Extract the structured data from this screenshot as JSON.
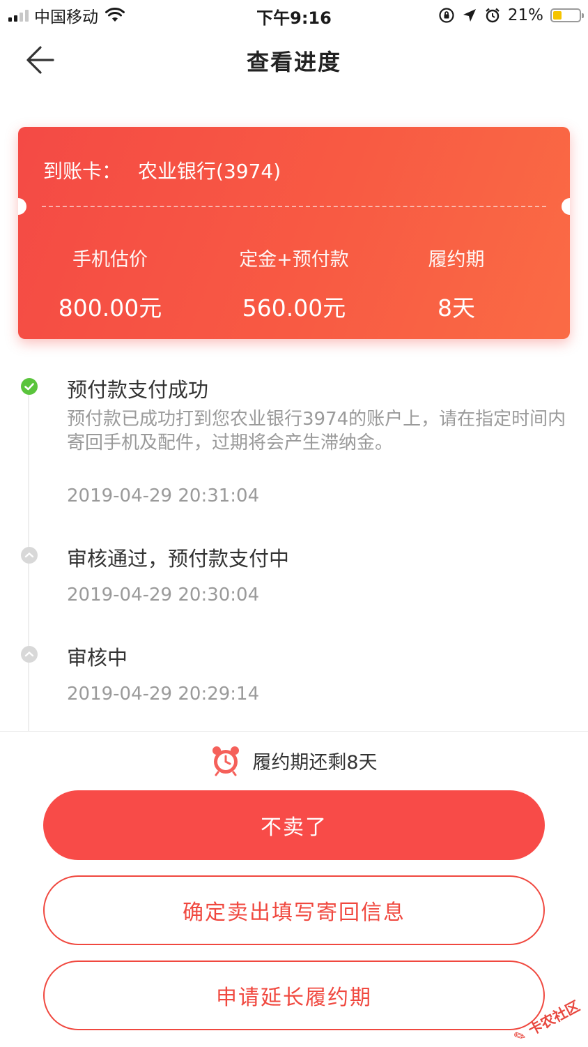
{
  "status_bar": {
    "carrier": "中国移动",
    "time": "下午9:16",
    "battery_percent": "21%",
    "battery_level": 0.21,
    "icons": [
      "signal-icon",
      "wifi-icon",
      "orientation-lock-icon",
      "location-icon",
      "alarm-icon",
      "battery-icon"
    ]
  },
  "nav": {
    "title": "查看进度",
    "back_icon": "back-arrow-icon"
  },
  "card": {
    "account_label": "到账卡：",
    "account_value": "农业银行(3974)",
    "stats": [
      {
        "label": "手机估价",
        "value": "800.00元"
      },
      {
        "label": "定金+预付款",
        "value": "560.00元"
      },
      {
        "label": "履约期",
        "value": "8天"
      }
    ],
    "colors": {
      "gradient_start": "#f44a45",
      "gradient_end": "#fa6b45"
    }
  },
  "timeline": {
    "items": [
      {
        "title": "预付款支付成功",
        "desc": "预付款已成功打到您农业银行3974的账户上，请在指定时间内寄回手机及配件，过期将会产生滞纳金。",
        "time": "2019-04-29 20:31:04",
        "status": "done"
      },
      {
        "title": "审核通过，预付款支付中",
        "time": "2019-04-29 20:30:04",
        "status": "pending"
      },
      {
        "title": "审核中",
        "time": "2019-04-29 20:29:14",
        "status": "pending"
      }
    ],
    "colors": {
      "done": "#5ac43c",
      "pending": "#d8d8d8"
    }
  },
  "bottom": {
    "countdown_icon": "alarm-clock-icon",
    "countdown_text": "履约期还剩8天",
    "buttons": {
      "cancel": "不卖了",
      "confirm": "确定卖出填写寄回信息",
      "extend": "申请延长履约期"
    },
    "colors": {
      "accent": "#f84b48"
    }
  },
  "watermark": "卡农社区"
}
